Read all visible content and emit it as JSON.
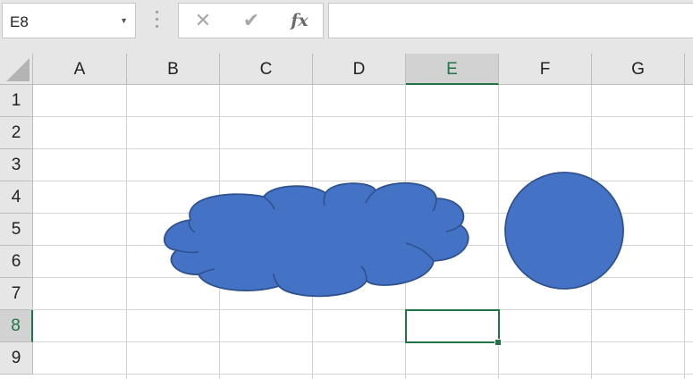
{
  "name_box": {
    "value": "E8",
    "dropdown_icon": "triangle-down-icon"
  },
  "formula_bar": {
    "cancel_icon": "✕",
    "enter_icon": "✔",
    "fx_label": "fx",
    "content": ""
  },
  "columns": [
    "A",
    "B",
    "C",
    "D",
    "E",
    "F",
    "G"
  ],
  "rows": [
    "1",
    "2",
    "3",
    "4",
    "5",
    "6",
    "7",
    "8",
    "9"
  ],
  "selected_cell": {
    "column": "E",
    "row": "8"
  },
  "shapes": [
    {
      "type": "cloud",
      "fill": "#4472c4",
      "stroke": "#2f528f"
    },
    {
      "type": "oval",
      "fill": "#4472c4",
      "stroke": "#2f528f"
    }
  ],
  "colors": {
    "accent": "#217346",
    "shape_fill": "#4472c4",
    "shape_outline": "#2f528f"
  }
}
